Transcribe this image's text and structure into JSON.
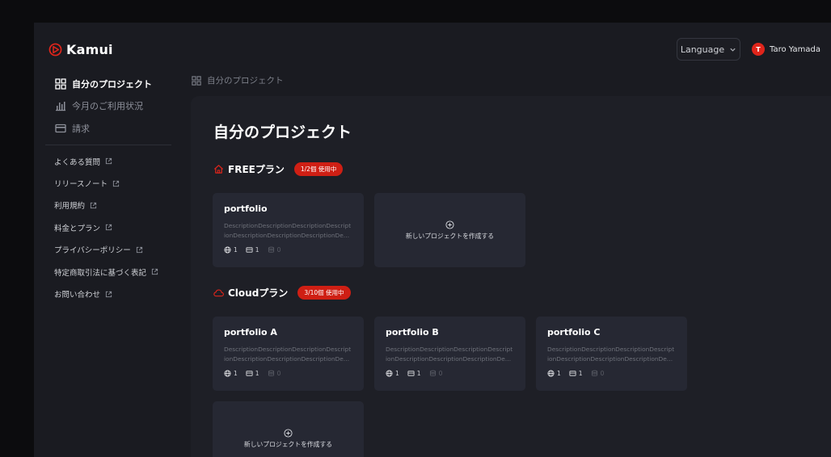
{
  "app": {
    "name": "Kamui"
  },
  "header": {
    "language_label": "Language",
    "user_initial": "T",
    "user_name": "Taro Yamada"
  },
  "sidebar": {
    "nav": [
      {
        "label": "自分のプロジェクト",
        "icon": "grid-icon",
        "active": true
      },
      {
        "label": "今月のご利用状況",
        "icon": "bar-chart-icon",
        "active": false
      },
      {
        "label": "請求",
        "icon": "credit-card-icon",
        "active": false
      }
    ],
    "links": [
      {
        "label": "よくある質問"
      },
      {
        "label": "リリースノート"
      },
      {
        "label": "利用規約"
      },
      {
        "label": "料金とプラン"
      },
      {
        "label": "プライバシーポリシー"
      },
      {
        "label": "特定商取引法に基づく表記"
      },
      {
        "label": "お問い合わせ"
      }
    ]
  },
  "breadcrumb": {
    "label": "自分のプロジェクト"
  },
  "main": {
    "title": "自分のプロジェクト",
    "new_project_label": "新しいプロジェクトを作成する",
    "plans": [
      {
        "name": "FREEプラン",
        "icon": "home-icon",
        "badge": "1/2個 使用中",
        "projects": [
          {
            "title": "portfolio",
            "description": "DescriptionDescriptionDescriptionDescriptionDescriptionDescriptionDescriptionDescription",
            "stats": [
              "1",
              "1",
              "0"
            ]
          }
        ]
      },
      {
        "name": "Cloudプラン",
        "icon": "cloud-icon",
        "badge": "3/10個 使用中",
        "projects": [
          {
            "title": "portfolio A",
            "description": "DescriptionDescriptionDescriptionDescriptionDescriptionDescriptionDescriptionDescription",
            "stats": [
              "1",
              "1",
              "0"
            ]
          },
          {
            "title": "portfolio B",
            "description": "DescriptionDescriptionDescriptionDescriptionDescriptionDescriptionDescriptionDescription",
            "stats": [
              "1",
              "1",
              "0"
            ]
          },
          {
            "title": "portfolio C",
            "description": "DescriptionDescriptionDescriptionDescriptionDescriptionDescriptionDescriptionDescription",
            "stats": [
              "1",
              "1",
              "0"
            ]
          }
        ]
      }
    ]
  },
  "colors": {
    "accent": "#e0251b",
    "background": "#1a1b21",
    "panel": "#1e1f26",
    "card": "#262833"
  }
}
